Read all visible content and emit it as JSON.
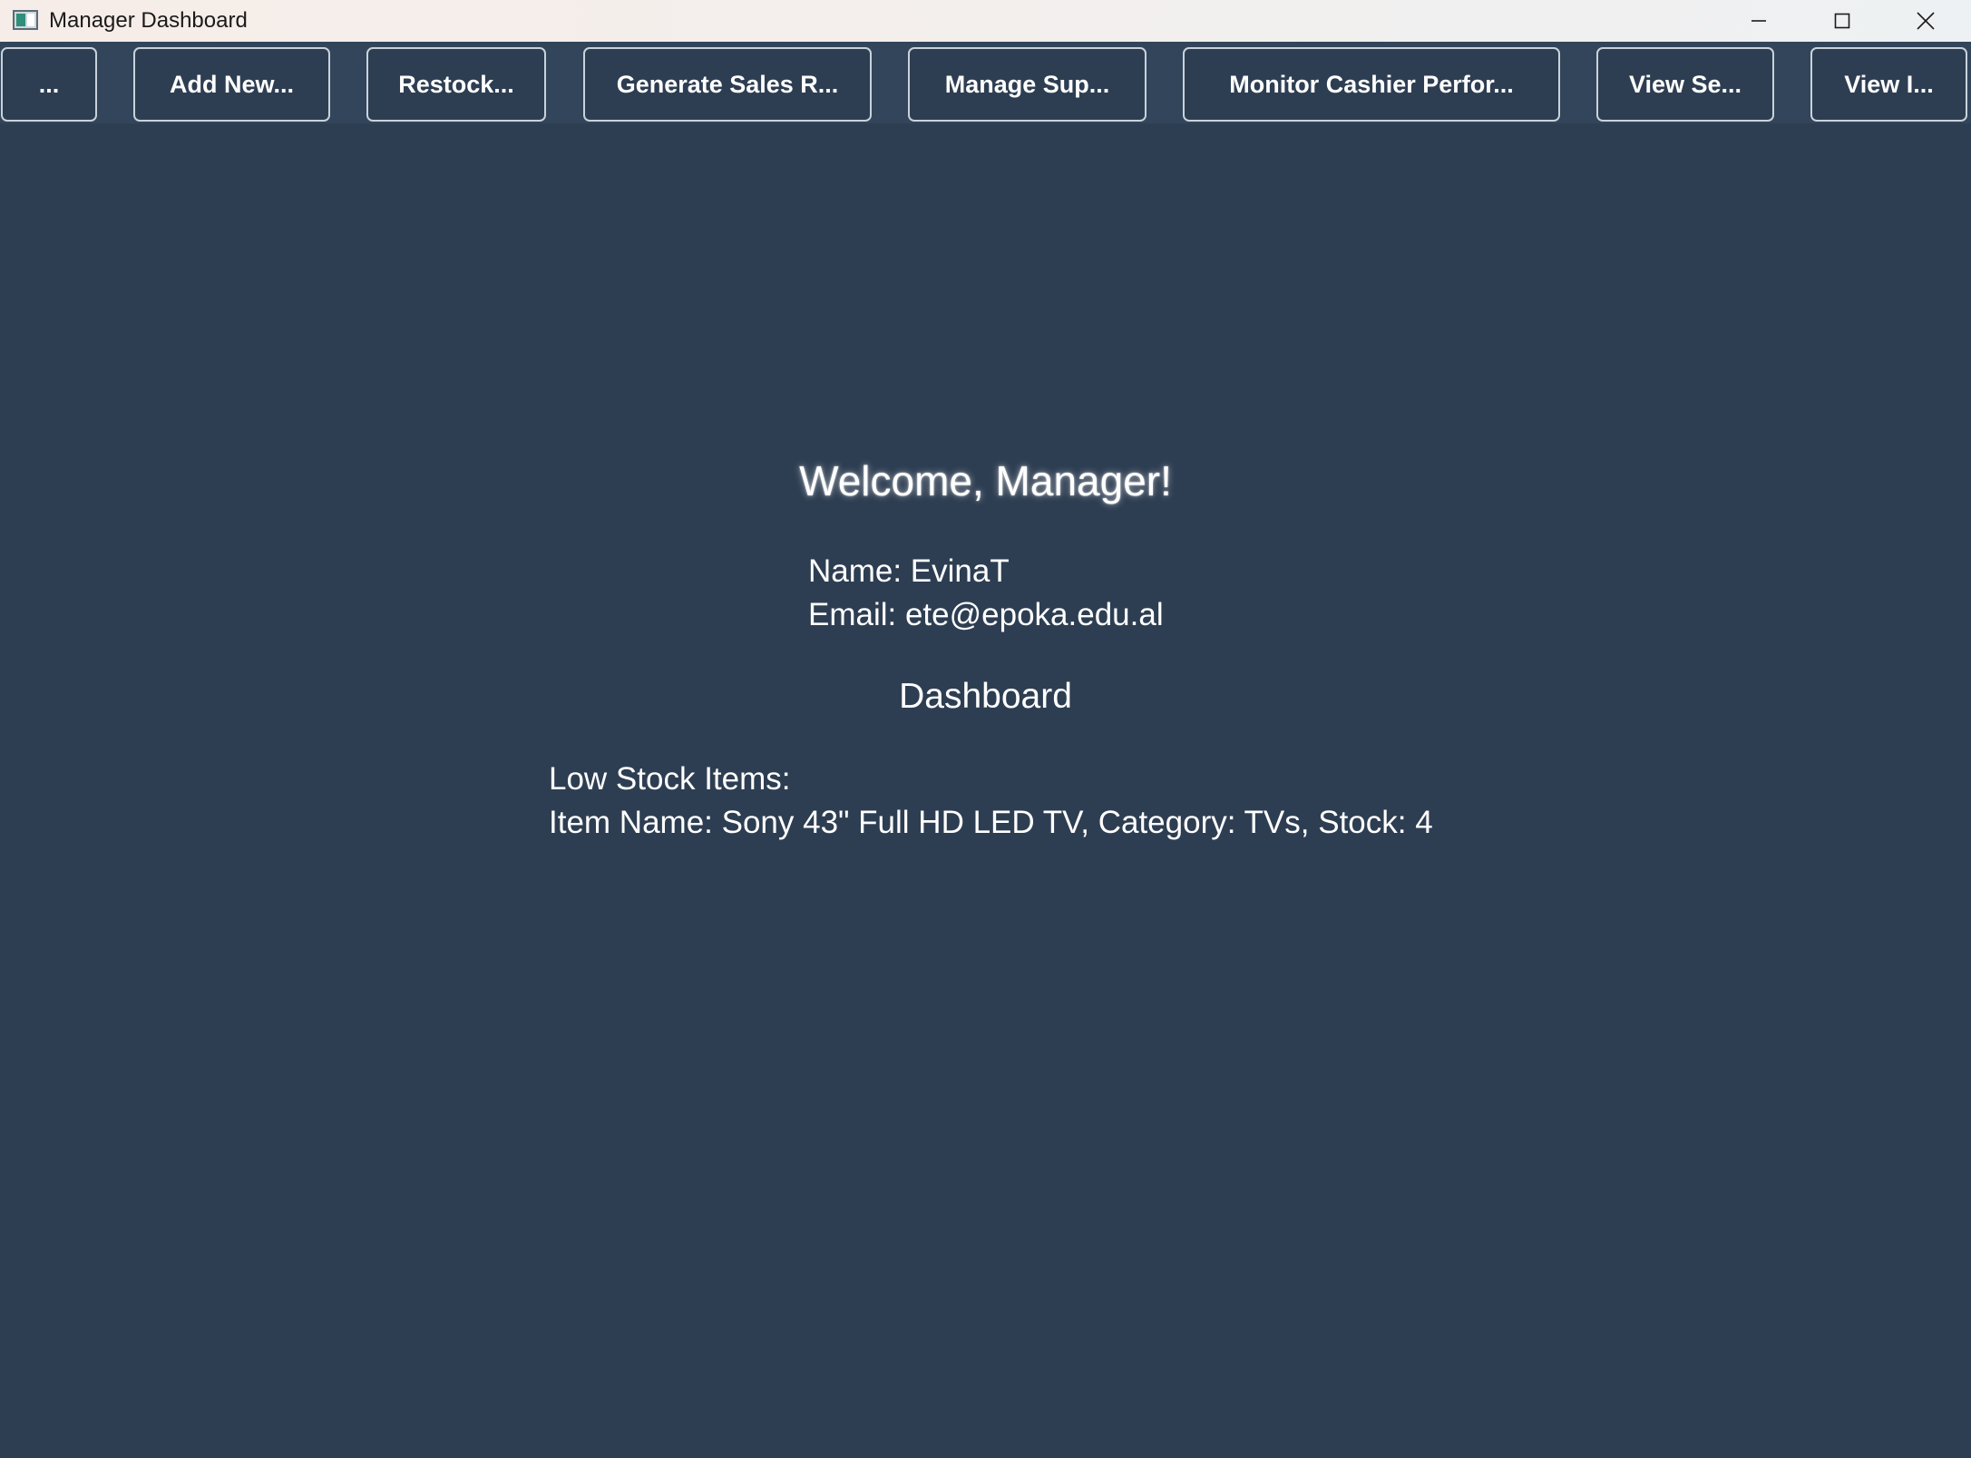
{
  "window": {
    "title": "Manager Dashboard"
  },
  "toolbar": {
    "buttons": [
      {
        "label": "..."
      },
      {
        "label": "Add New..."
      },
      {
        "label": "Restock..."
      },
      {
        "label": "Generate Sales R..."
      },
      {
        "label": "Manage Sup..."
      },
      {
        "label": "Monitor Cashier Perfor..."
      },
      {
        "label": "View Se..."
      },
      {
        "label": "View I..."
      }
    ]
  },
  "main": {
    "welcome": "Welcome, Manager!",
    "name_line": "Name: EvinaT",
    "email_line": "Email: ete@epoka.edu.al",
    "dashboard_title": "Dashboard",
    "low_stock_heading": "Low Stock Items:",
    "low_stock_items": [
      "Item Name: Sony 43\" Full HD LED TV, Category: TVs, Stock: 4"
    ]
  },
  "colors": {
    "background": "#2e3e52",
    "toolbar": "#33455a",
    "button_border": "#c9d2dc",
    "text": "#ffffff"
  },
  "icons": {
    "app": "app-window-icon",
    "minimize": "minimize-icon",
    "maximize": "maximize-icon",
    "close": "close-icon"
  }
}
